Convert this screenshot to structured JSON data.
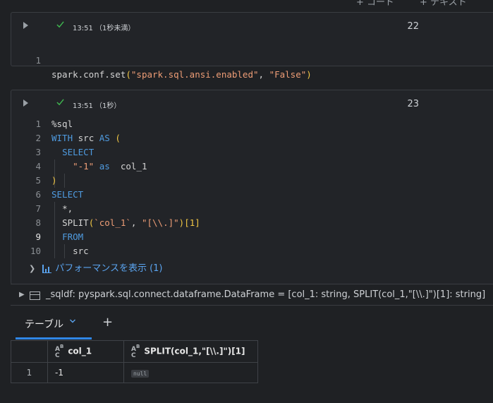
{
  "toolbar": {
    "add_code": "+ コード",
    "add_text": "+ テキスト"
  },
  "cell1": {
    "status_time": "13:51",
    "status_duration": "（1秒未満）",
    "cell_number": "22",
    "line_numbers": [
      "1"
    ],
    "code": {
      "fn": "spark.conf.set",
      "arg1": "\"spark.sql.ansi.enabled\"",
      "arg2": "\"False\""
    }
  },
  "cell2": {
    "status_time": "13:51",
    "status_duration": "（1秒）",
    "cell_number": "23",
    "line_numbers": [
      "1",
      "2",
      "3",
      "4",
      "5",
      "6",
      "7",
      "8",
      "9",
      "10"
    ],
    "code": {
      "l1": "%sql",
      "l2_kw1": "WITH",
      "l2_name": "src",
      "l2_kw2": "AS",
      "l2_par": "(",
      "l3_kw": "SELECT",
      "l4_str": "\"-1\"",
      "l4_kw": "as",
      "l4_col": "col_1",
      "l5_par": ")",
      "l6_kw": "SELECT",
      "l7": "*,",
      "l8_fn": "SPLIT",
      "l8_par1": "(",
      "l8_arg1": "`col_1`",
      "l8_comma": ", ",
      "l8_arg2": "\"[\\\\.]\"",
      "l8_par2": ")",
      "l8_idx": "[1]",
      "l9_kw": "FROM",
      "l10": "src"
    },
    "performance_label": "パフォーマンスを表示 (1)"
  },
  "dataframe_info": "_sqldf:  pyspark.sql.connect.dataframe.DataFrame = [col_1: string, SPLIT(col_1,\"[\\\\.]\")[1]: string]",
  "results": {
    "tab_label": "テーブル",
    "columns": [
      "col_1",
      "SPLIT(col_1,\"[\\\\.]\")[1]"
    ],
    "rows": [
      {
        "index": "1",
        "col_1": "-1",
        "split": "null"
      }
    ]
  },
  "colors": {
    "accent": "#2f86e6",
    "success": "#3fb950",
    "keyword": "#4f9be0",
    "string": "#ee9d76",
    "paren": "#f2c744"
  }
}
